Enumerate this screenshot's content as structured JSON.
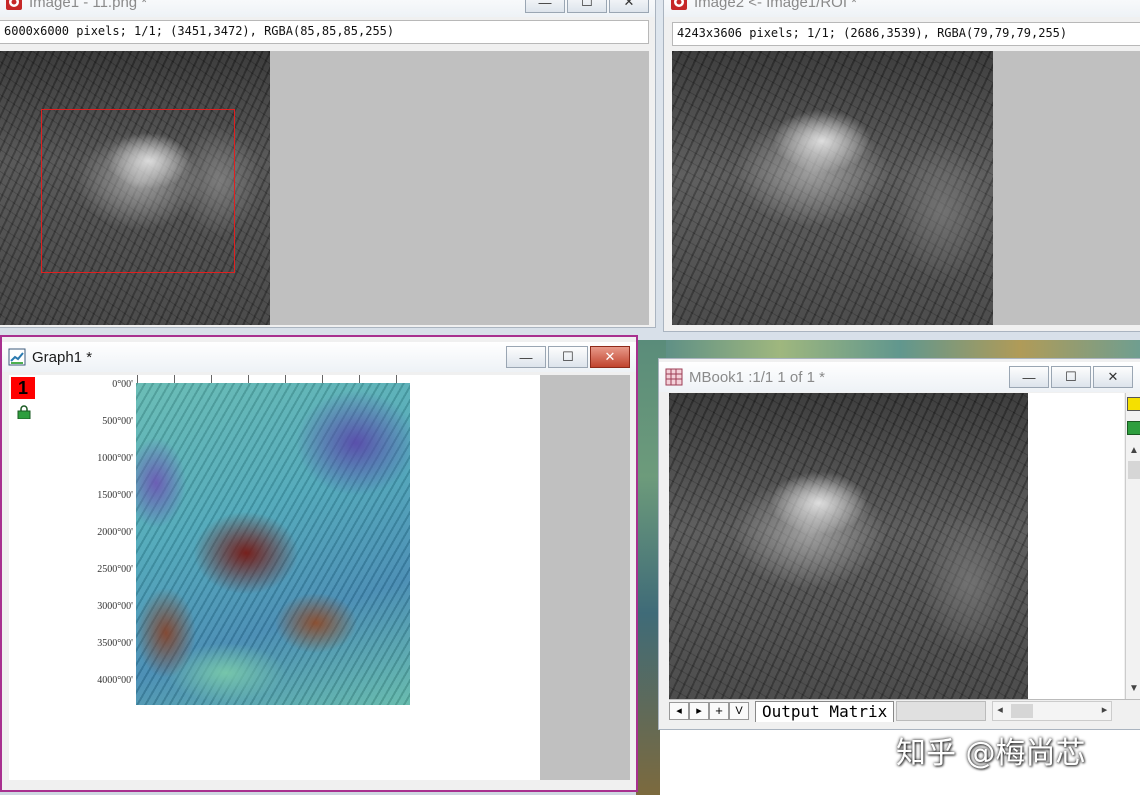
{
  "image1": {
    "title": "Image1 - 11.png *",
    "info": "6000x6000 pixels; 1/1; (3451,3472), RGBA(85,85,85,255)"
  },
  "image2": {
    "title": "Image2 <- Image1/ROI *",
    "info": "4243x3606 pixels; 1/1; (2686,3539), RGBA(79,79,79,255)"
  },
  "graph1": {
    "title": "Graph1 *",
    "layer_number": "1",
    "y_ticks": [
      "0°00'",
      "500°00'",
      "1000°00'",
      "1500°00'",
      "2000°00'",
      "2500°00'",
      "3000°00'",
      "3500°00'",
      "4000°00'"
    ]
  },
  "mbook1": {
    "title": "MBook1 :1/1 1 of 1 *",
    "sheet_tab": "Output Matrix",
    "nav_buttons": [
      "◂",
      "▸",
      "+",
      "V"
    ]
  },
  "window_controls": {
    "minimize": "—",
    "maximize": "☐",
    "close": "✕"
  },
  "watermark": "知乎 @梅尚芯",
  "colors": {
    "active_border": "#a8308f",
    "roi_border": "#e02020",
    "layer_badge": "#ff0000"
  }
}
